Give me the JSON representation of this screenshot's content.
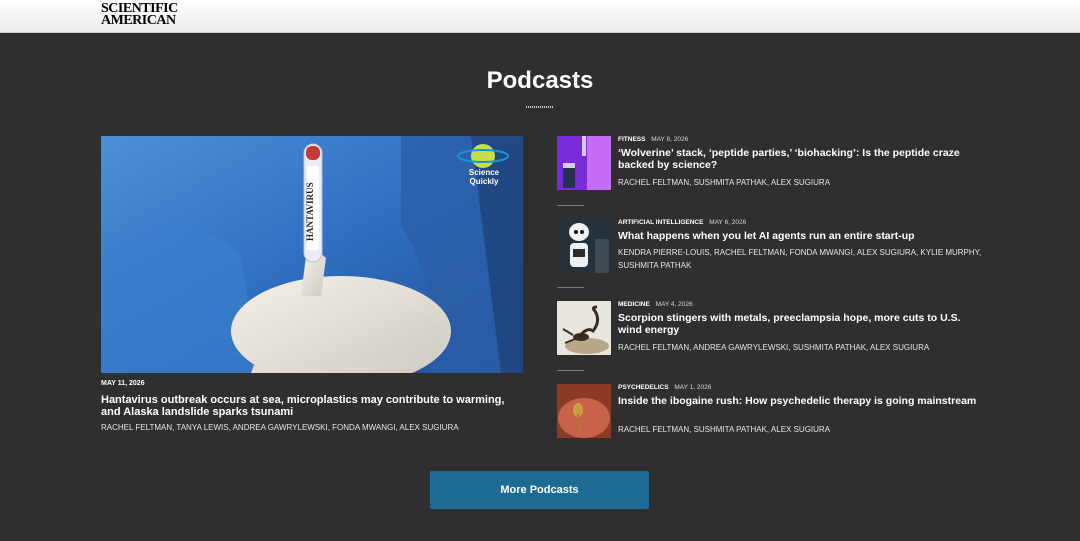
{
  "header": {
    "logo_line1": "SCIENTIFIC",
    "logo_line2": "AMERICAN"
  },
  "section": {
    "title": "Podcasts"
  },
  "hero": {
    "image_badge": "Science Quickly",
    "tube_label": "HANTAVIRUS",
    "date": "MAY 11, 2026",
    "title": "Hantavirus outbreak occurs at sea, microplastics may contribute to warming, and Alaska landslide sparks tsunami",
    "authors": "RACHEL FELTMAN, TANYA LEWIS, ANDREA GAWRYLEWSKI, FONDA MWANGI, ALEX SUGIURA"
  },
  "items": [
    {
      "category": "FITNESS",
      "date": "MAY 8, 2026",
      "title": "‘Wolverine’ stack, ‘peptide parties,’ ‘biohacking’: Is the peptide craze backed by science?",
      "authors": "RACHEL FELTMAN, SUSHMITA PATHAK, ALEX SUGIURA"
    },
    {
      "category": "ARTIFICIAL INTELLIGENCE",
      "date": "MAY 6, 2026",
      "title": "What happens when you let AI agents run an entire start-up",
      "authors": "KENDRA PIERRE-LOUIS, RACHEL FELTMAN, FONDA MWANGI, ALEX SUGIURA, KYLIE MURPHY, SUSHMITA PATHAK"
    },
    {
      "category": "MEDICINE",
      "date": "MAY 4, 2026",
      "title": "Scorpion stingers with metals, preeclampsia hope, more cuts to U.S. wind energy",
      "authors": "RACHEL FELTMAN, ANDREA GAWRYLEWSKI, SUSHMITA PATHAK, ALEX SUGIURA"
    },
    {
      "category": "PSYCHEDELICS",
      "date": "MAY 1, 2026",
      "title": "Inside the ibogaine rush: How psychedelic therapy is going mainstream",
      "authors": "RACHEL FELTMAN, SUSHMITA PATHAK, ALEX SUGIURA"
    }
  ],
  "more_button": {
    "label": "More Podcasts"
  },
  "colors": {
    "background": "#2f2f2f",
    "button": "#1d6a93"
  }
}
